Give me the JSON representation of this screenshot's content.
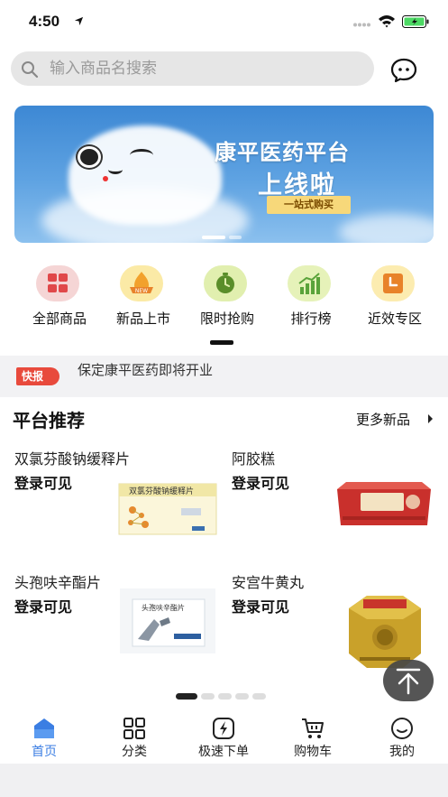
{
  "status_bar": {
    "time": "4:50"
  },
  "search": {
    "placeholder": "输入商品名搜索"
  },
  "banner": {
    "title_line1": "康平医药平台",
    "title_line2": "上线啦",
    "tag": "一站式购买"
  },
  "quick_menu": [
    {
      "label": "全部商品",
      "icon": "grid-icon",
      "color": "#f5d5d5",
      "accent": "#e0484a"
    },
    {
      "label": "新品上市",
      "icon": "new-badge-icon",
      "color": "#fbeaa6",
      "accent": "#f2a12c"
    },
    {
      "label": "限时抢购",
      "icon": "timer-icon",
      "color": "#e1efaf",
      "accent": "#5a8e2a"
    },
    {
      "label": "排行榜",
      "icon": "chart-icon",
      "color": "#e6f2b9",
      "accent": "#5aa33a"
    },
    {
      "label": "近效专区",
      "icon": "calendar-icon",
      "color": "#fcecb0",
      "accent": "#e8832a"
    }
  ],
  "ticker": {
    "badge": "快报",
    "text": "保定康平医药即将开业"
  },
  "recommend": {
    "title": "平台推荐",
    "more": "更多新品",
    "items": [
      {
        "name": "双氯芬酸钠缓释片",
        "price": "登录可见"
      },
      {
        "name": "阿胶糕",
        "price": "登录可见"
      },
      {
        "name": "头孢呋辛酯片",
        "price": "登录可见"
      },
      {
        "name": "安宫牛黄丸",
        "price": "登录可见"
      }
    ],
    "package_labels": {
      "diclofenac": "双氯芬酸钠缓释片",
      "cefuroxime": "头孢呋辛酯片",
      "angong": "安宫牛黄丸"
    }
  },
  "tabbar": [
    {
      "label": "首页",
      "active": true
    },
    {
      "label": "分类",
      "active": false
    },
    {
      "label": "极速下单",
      "active": false
    },
    {
      "label": "购物车",
      "active": false
    },
    {
      "label": "我的",
      "active": false
    }
  ],
  "colors": {
    "accent": "#3b7ee3",
    "ticker_badge": "#e84a3c"
  }
}
